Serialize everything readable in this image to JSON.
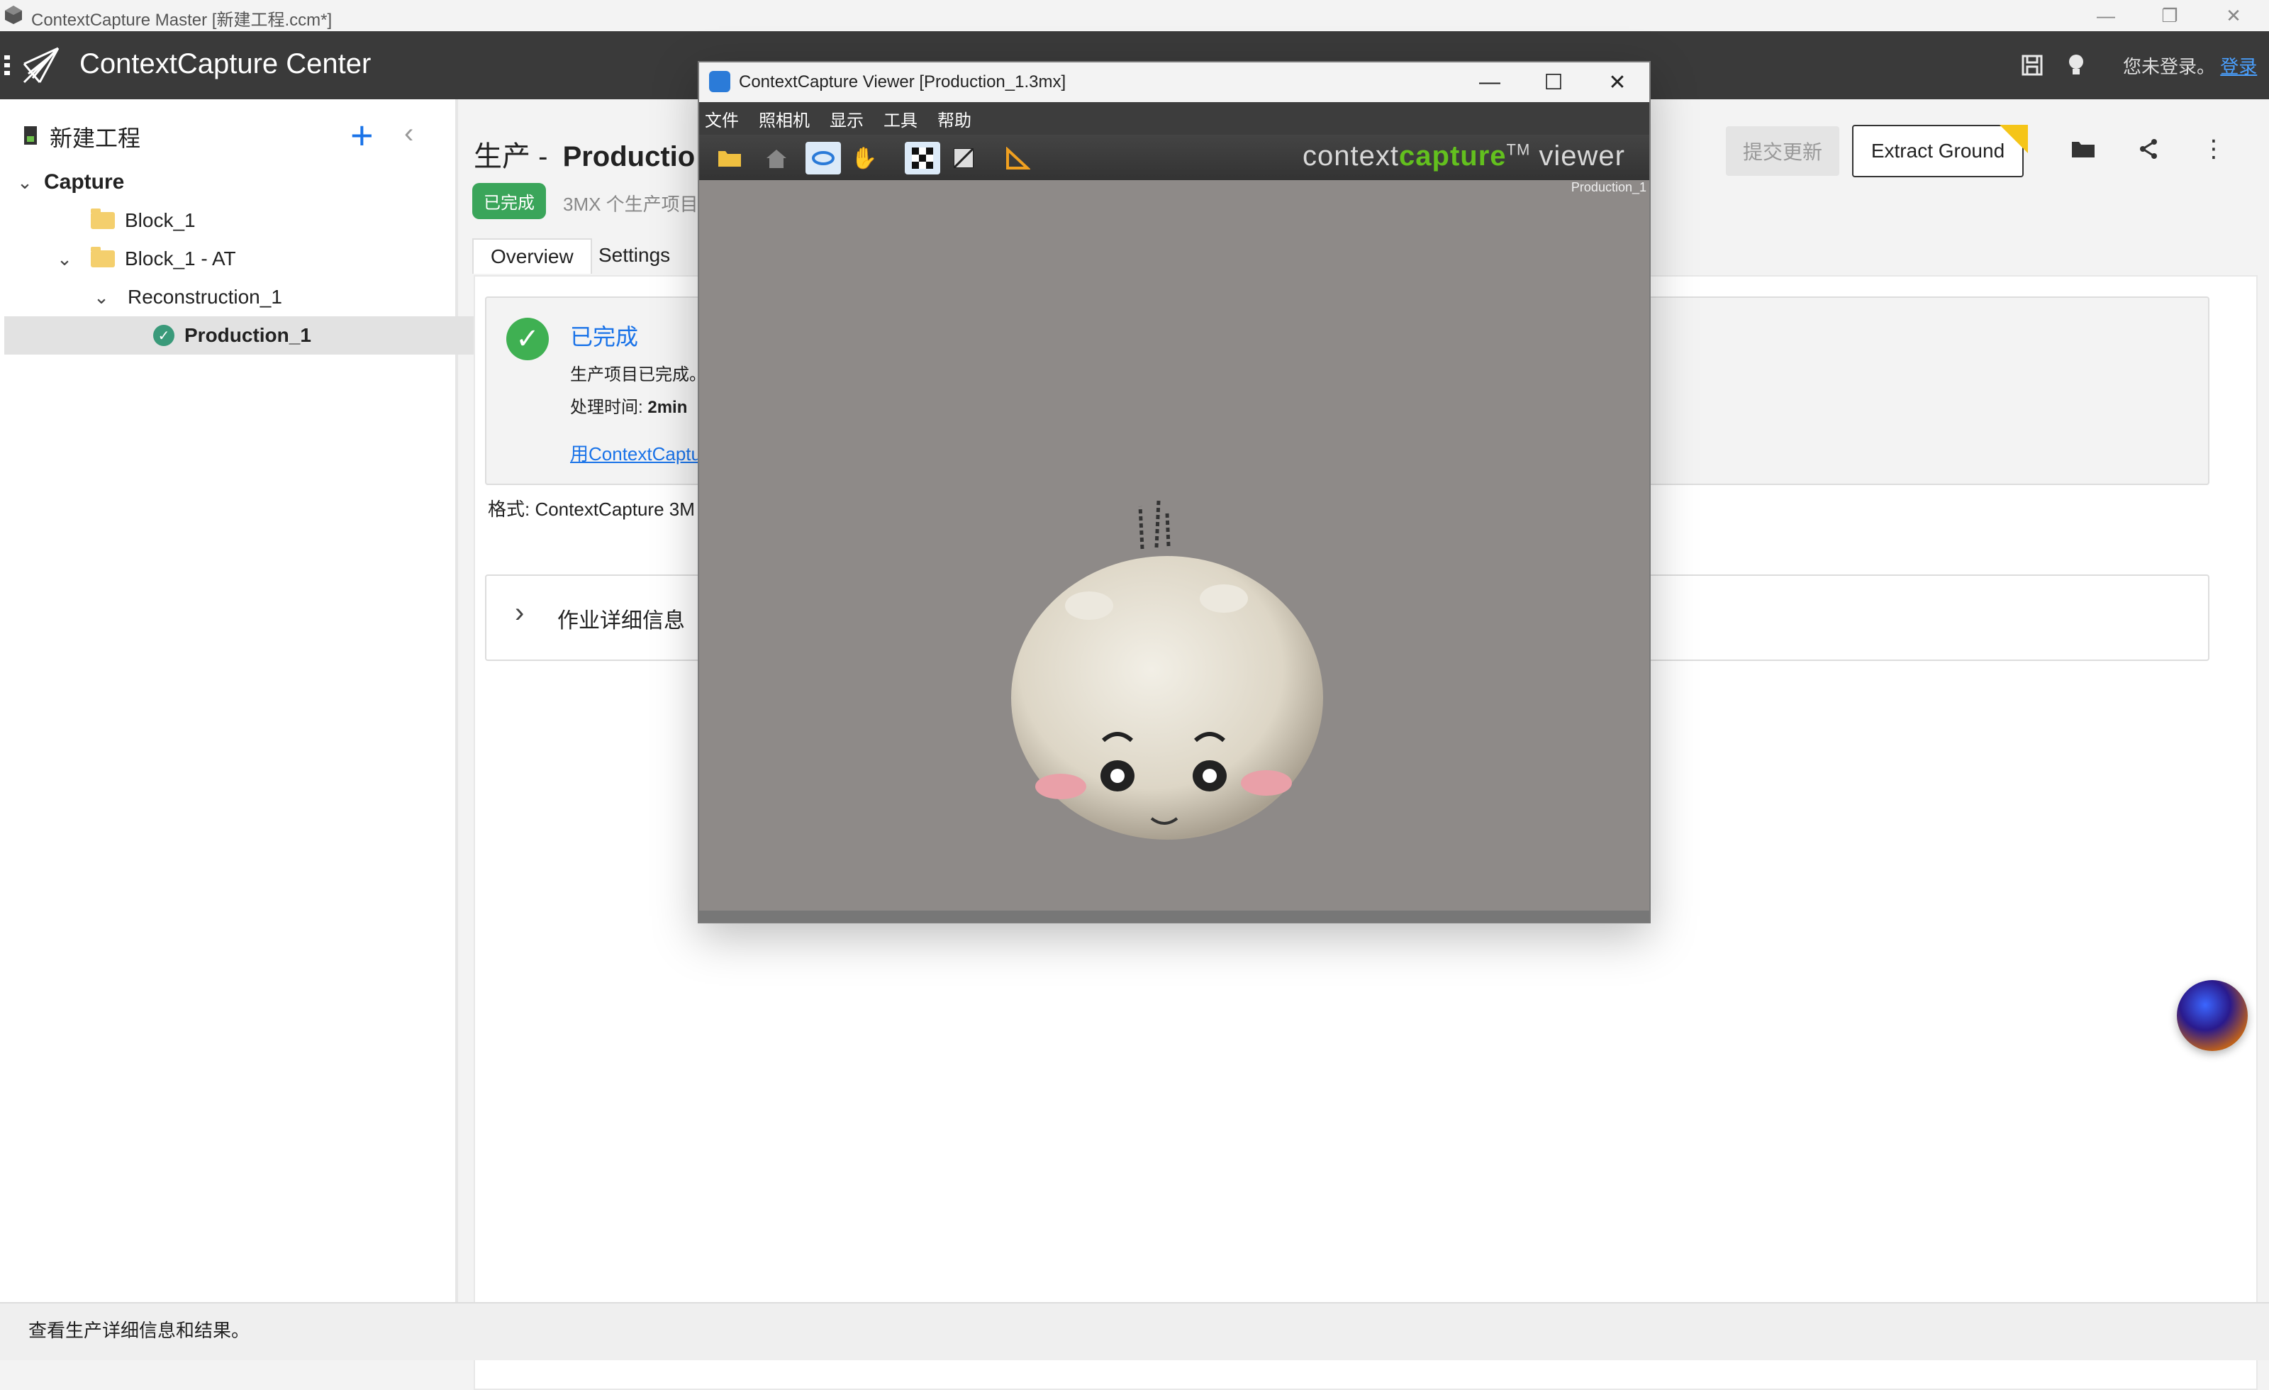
{
  "window": {
    "title": "ContextCapture Master [新建工程.ccm*]"
  },
  "app_header": {
    "title": "ContextCapture Center",
    "login_text": "您未登录。",
    "login_link": "登录"
  },
  "sidebar": {
    "project_title": "新建工程",
    "tree": [
      {
        "label": "Capture",
        "level": 0,
        "expanded": true,
        "type": "root"
      },
      {
        "label": "Block_1",
        "level": 1,
        "type": "block"
      },
      {
        "label": "Block_1 - AT",
        "level": 1,
        "expanded": true,
        "type": "block"
      },
      {
        "label": "Reconstruction_1",
        "level": 2,
        "expanded": true,
        "type": "reconstruction"
      },
      {
        "label": "Production_1",
        "level": 3,
        "type": "production",
        "selected": true
      }
    ]
  },
  "main": {
    "title_prefix": "生产 -",
    "title_name": "Productio",
    "status_badge": "已完成",
    "subtitle": "3MX 个生产项目",
    "tabs": [
      "Overview",
      "Settings"
    ],
    "submit_button": "提交更新",
    "extract_button": "Extract Ground",
    "card": {
      "status": "已完成",
      "line1": "生产项目已完成。",
      "processing_label": "处理时间:",
      "processing_value": "2min",
      "link_text": "用ContextCaptu"
    },
    "format_line": "格式: ContextCapture 3M",
    "details_label": "作业详细信息"
  },
  "viewer": {
    "title": "ContextCapture Viewer [Production_1.3mx]",
    "menu": [
      "文件",
      "照相机",
      "显示",
      "工具",
      "帮助"
    ],
    "brand_pre": "context",
    "brand_bold": "capture",
    "brand_tm": "TM",
    "brand_post": "viewer",
    "corner_label": "Production_1"
  },
  "statusbar": {
    "text": "查看生产详细信息和结果。"
  },
  "colors": {
    "accent": "#1a73e8",
    "success": "#3aa55a",
    "header_bg": "#3a3a3a",
    "brand_green": "#63c01e"
  }
}
